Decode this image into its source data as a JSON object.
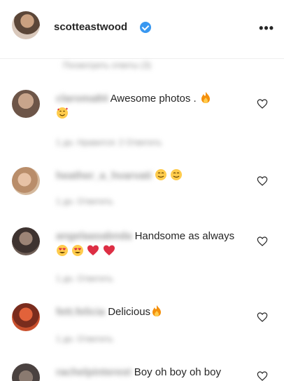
{
  "post": {
    "username": "scotteastwood",
    "more_label": "•••"
  },
  "load_more": {
    "label": "Посмотреть ответы (3)"
  },
  "comments": [
    {
      "username": "claroma84",
      "text": "Awesome photos . ",
      "meta": "1 дн.   Нравится: 2   Ответить"
    },
    {
      "username": "heather_a_hvarvati",
      "text": "",
      "meta": "1 дн.   Ответить"
    },
    {
      "username": "angelaasabnda",
      "text": "Handsome as always ",
      "meta": "1 дн.   Ответить"
    },
    {
      "username": "fett.felicia",
      "text": "Delicious",
      "meta": "1 дн.   Ответить"
    },
    {
      "username": "rachelpinterest",
      "text": "Boy oh boy oh boy",
      "meta": ""
    }
  ],
  "colors": {
    "verified": "#3897f0",
    "text": "#262626",
    "muted": "#8e8e8e"
  }
}
